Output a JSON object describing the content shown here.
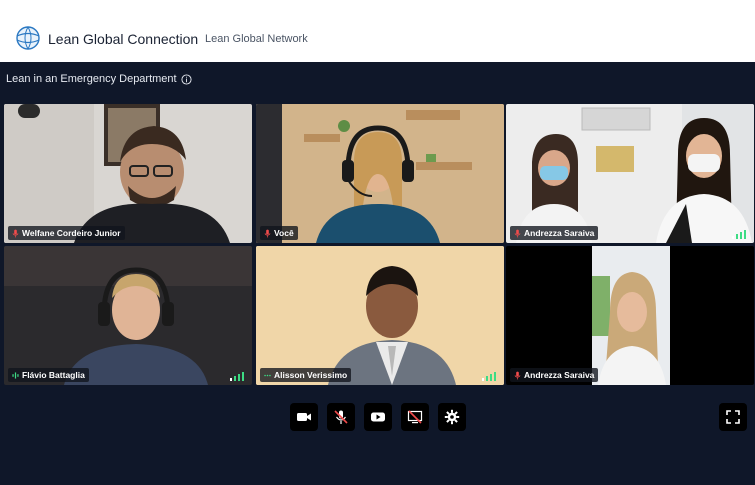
{
  "header": {
    "app_title": "Lean Global Connection",
    "network_link": "Lean Global Network",
    "logo_icon": "globe-icon"
  },
  "meeting": {
    "title": "Lean in an Emergency Department",
    "info_icon": "info-icon"
  },
  "participants": [
    {
      "name": "Welfane Cordeiro Junior",
      "mic": "muted"
    },
    {
      "name": "Você",
      "mic": "muted"
    },
    {
      "name": "Andrezza Saraiva",
      "mic": "muted"
    },
    {
      "name": "Flávio Battaglia",
      "mic": "speaking"
    },
    {
      "name": "Alisson Verissimo",
      "mic": "active"
    },
    {
      "name": "Andrezza Saraiva",
      "mic": "muted"
    }
  ],
  "controls": [
    {
      "name": "camera-button",
      "icon": "video-camera-icon"
    },
    {
      "name": "mute-button",
      "icon": "microphone-off-icon"
    },
    {
      "name": "youtube-button",
      "icon": "youtube-icon"
    },
    {
      "name": "screen-share-button",
      "icon": "screen-share-off-icon"
    },
    {
      "name": "settings-button",
      "icon": "gear-icon"
    }
  ],
  "fullscreen_icon": "fullscreen-icon",
  "colors": {
    "background": "#0f1729",
    "header": "#ffffff",
    "mic_muted": "#f24b4b",
    "mic_active": "#3ddc84",
    "control_bg": "#000000"
  }
}
